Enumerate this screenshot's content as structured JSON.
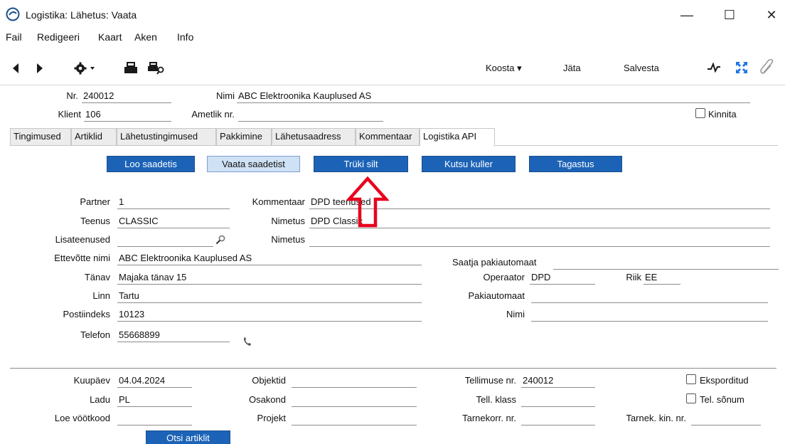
{
  "window": {
    "title": "Logistika: Lähetus: Vaata",
    "minimize": "—",
    "maximize": "☐",
    "close": "✕"
  },
  "menu": [
    "Fail",
    "Redigeeri",
    "Kaart",
    "Aken",
    "Info"
  ],
  "toolbar": {
    "koosta": "Koosta ▾",
    "jata": "Jäta",
    "salvesta": "Salvesta"
  },
  "header": {
    "nr_label": "Nr.",
    "nr_value": "240012",
    "nimi_label": "Nimi",
    "nimi_value": "ABC Elektroonika Kauplused AS",
    "klient_label": "Klient",
    "klient_value": "106",
    "ametlik_label": "Ametlik nr.",
    "ametlik_value": "",
    "kinnita_label": "Kinnita"
  },
  "tabs": [
    "Tingimused",
    "Artiklid",
    "Lähetustingimused",
    "Pakkimine",
    "Lähetusaadress",
    "Kommentaar",
    "Logistika API"
  ],
  "buttons": {
    "loo": "Loo saadetis",
    "vaata": "Vaata saadetist",
    "truki": "Trüki silt",
    "kutsu": "Kutsu kuller",
    "tagastus": "Tagastus"
  },
  "form": {
    "partner_label": "Partner",
    "partner_value": "1",
    "kommentaar_label": "Kommentaar",
    "kommentaar_value": "DPD teenused",
    "teenus_label": "Teenus",
    "teenus_value": "CLASSIC",
    "nimetus1_label": "Nimetus",
    "nimetus1_value": "DPD Classic",
    "lisateenused_label": "Lisateenused",
    "lisateenused_value": "",
    "nimetus2_label": "Nimetus",
    "nimetus2_value": "",
    "ettevotte_label": "Ettevõtte nimi",
    "ettevotte_value": "ABC Elektroonika Kauplused AS",
    "saatja_label": "Saatja pakiautomaat",
    "saatja_value": "",
    "tanav_label": "Tänav",
    "tanav_value": "Majaka tänav 15",
    "operaator_label": "Operaator",
    "operaator_value": "DPD",
    "riik_label": "Riik",
    "riik_value": "EE",
    "linn_label": "Linn",
    "linn_value": "Tartu",
    "pakiautomaat_label": "Pakiautomaat",
    "pakiautomaat_value": "",
    "postiindeks_label": "Postiindeks",
    "postiindeks_value": "10123",
    "nimi_label": "Nimi",
    "nimi_value": "",
    "telefon_label": "Telefon",
    "telefon_value": "55668899"
  },
  "bottom": {
    "kuupaev_label": "Kuupäev",
    "kuupaev_value": "04.04.2024",
    "objektid_label": "Objektid",
    "objektid_value": "",
    "tellimuse_label": "Tellimuse nr.",
    "tellimuse_value": "240012",
    "eksporditud_label": "Eksporditud",
    "ladu_label": "Ladu",
    "ladu_value": "PL",
    "osakond_label": "Osakond",
    "osakond_value": "",
    "tellklass_label": "Tell. klass",
    "tellklass_value": "",
    "telsonum_label": "Tel. sõnum",
    "loe_label": "Loe vöötkood",
    "loe_value": "",
    "projekt_label": "Projekt",
    "projekt_value": "",
    "tarnekorr_label": "Tarnekorr. nr.",
    "tarnekorr_value": "",
    "tarnekkin_label": "Tarnek. kin. nr.",
    "tarnekkin_value": "",
    "otsi": "Otsi artiklit"
  },
  "colors": {
    "button_blue": "#1c63b7",
    "button_light": "#cfe1f5",
    "annotation_arrow": "#e8001c",
    "expand_icon": "#1a73e8"
  },
  "icons": [
    "app-logo-icon",
    "back-arrow-icon",
    "forward-arrow-icon",
    "gear-icon",
    "print-icon",
    "print-preview-icon",
    "activity-icon",
    "expand-icon",
    "attachment-icon",
    "search-icon",
    "phone-icon",
    "up-arrow-annotation-icon"
  ]
}
